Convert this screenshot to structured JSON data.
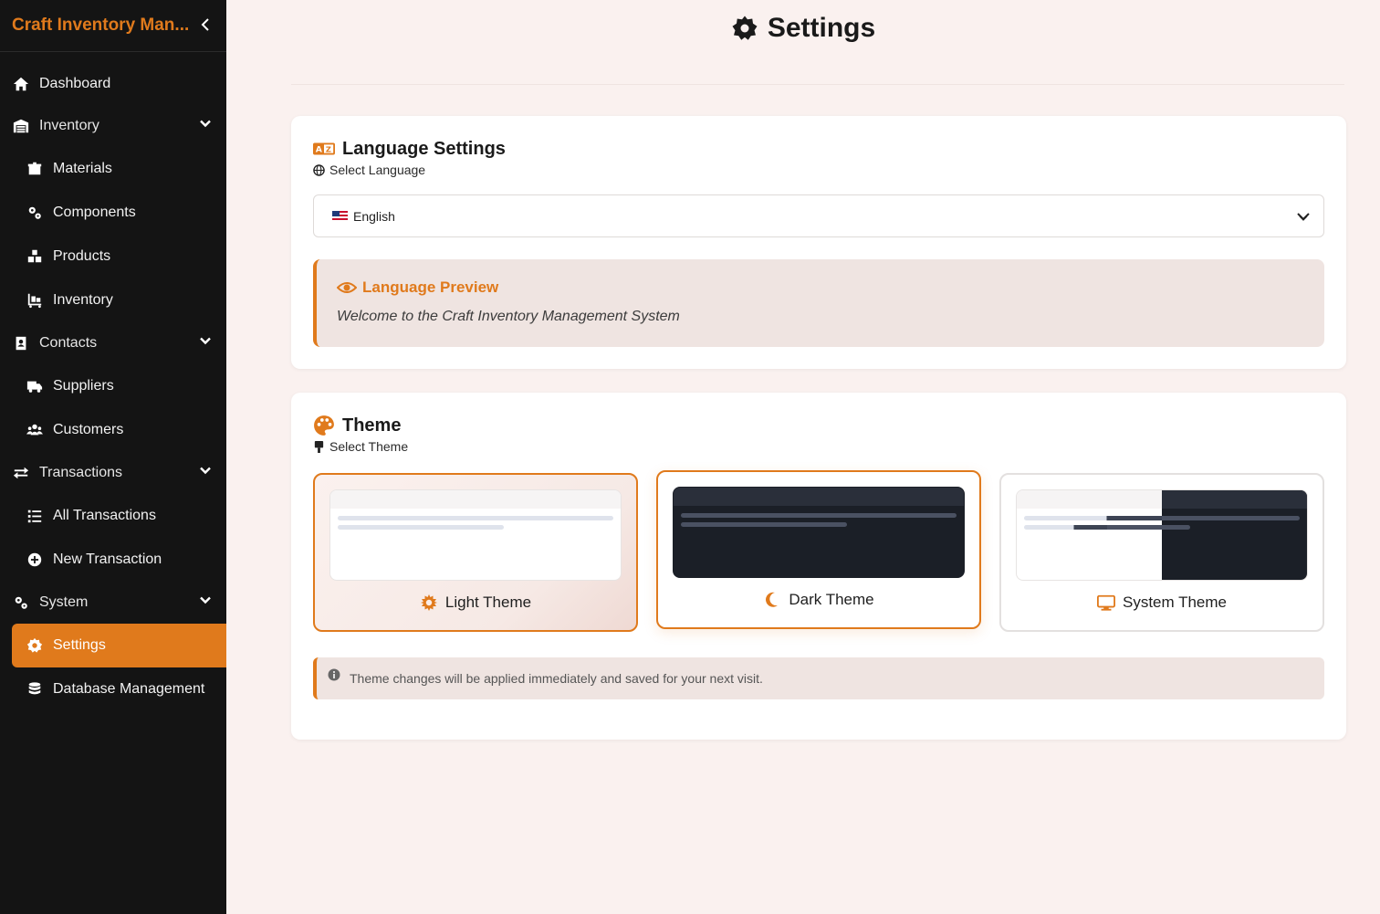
{
  "sidebar": {
    "brand": "Craft Inventory Man...",
    "items": {
      "dashboard": "Dashboard",
      "inventory_group": "Inventory",
      "materials": "Materials",
      "components": "Components",
      "products": "Products",
      "inventory": "Inventory",
      "contacts_group": "Contacts",
      "suppliers": "Suppliers",
      "customers": "Customers",
      "transactions_group": "Transactions",
      "all_transactions": "All Transactions",
      "new_transaction": "New Transaction",
      "system_group": "System",
      "settings": "Settings",
      "database_management": "Database Management"
    }
  },
  "page": {
    "title": "Settings"
  },
  "language": {
    "title": "Language Settings",
    "subtitle": "Select Language",
    "selected": "English",
    "preview_title": "Language Preview",
    "preview_text": "Welcome to the Craft Inventory Management System"
  },
  "theme": {
    "title": "Theme",
    "subtitle": "Select Theme",
    "options": [
      "Light Theme",
      "Dark Theme",
      "System Theme"
    ],
    "selected": "Dark Theme",
    "note": "Theme changes will be applied immediately and saved for your next visit."
  },
  "colors": {
    "accent": "#e07a1c",
    "sidebar": "#141414",
    "background": "#faf1ef"
  }
}
